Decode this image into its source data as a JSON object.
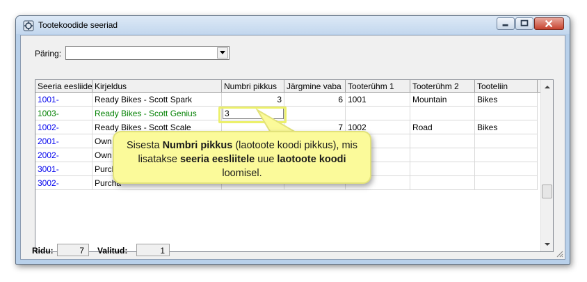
{
  "window": {
    "title": "Tootekoodide seeriad"
  },
  "query": {
    "label": "Päring:",
    "value": ""
  },
  "grid": {
    "columns": [
      "Seeria eesliide",
      "Kirjeldus",
      "Numbri pikkus",
      "Järgmine vaba",
      "Tooterühm 1",
      "Tooterühm 2",
      "Tooteliin"
    ],
    "rows": [
      {
        "prefix": "1001-",
        "desc": "Ready Bikes - Scott Spark",
        "len": "3",
        "next": "6",
        "g1": "1001",
        "g2": "Mountain",
        "line": "Bikes",
        "color": "blue"
      },
      {
        "prefix": "1003-",
        "desc": "Ready Bikes - Scott Genius",
        "len": "3",
        "next": "",
        "g1": "",
        "g2": "",
        "line": "",
        "color": "green"
      },
      {
        "prefix": "1002-",
        "desc": "Ready Bikes - Scott Scale",
        "len": "",
        "next": "7",
        "g1": "1002",
        "g2": "Road",
        "line": "Bikes",
        "color": "blue"
      },
      {
        "prefix": "2001-",
        "desc": "Own",
        "len": "",
        "next": "",
        "g1": "",
        "g2": "",
        "line": "",
        "color": "blue"
      },
      {
        "prefix": "2002-",
        "desc": "Own",
        "len": "",
        "next": "",
        "g1": "",
        "g2": "",
        "line": "",
        "color": "blue"
      },
      {
        "prefix": "3001-",
        "desc": "Purch",
        "len": "",
        "next": "",
        "g1": "",
        "g2": "",
        "line": "",
        "color": "blue"
      },
      {
        "prefix": "3002-",
        "desc": "Purcha",
        "len": "",
        "next": "",
        "g1": "",
        "g2": "",
        "line": "",
        "color": "blue"
      }
    ]
  },
  "callout": {
    "t1": "Sisesta ",
    "b1": "Numbri pikkus",
    "t2": " (laotoote koodi pikkus), mis lisatakse ",
    "b2": "seeria eesliitele",
    "t3": " uue ",
    "b3": "laotoote koodi",
    "t4": " loomisel."
  },
  "status": {
    "rows_label": "Ridu:",
    "rows_value": "7",
    "selected_label": "Valitud:",
    "selected_value": "1"
  },
  "colors": {
    "link": "#0000ee",
    "active": "#008000",
    "callout": "#fbfa9a",
    "highlight": "#ecf06b"
  },
  "icons": [
    "app-icon",
    "minimize-icon",
    "maximize-icon",
    "close-icon",
    "chevron-down-icon",
    "scroll-up-icon",
    "scroll-down-icon",
    "resize-grip-icon"
  ]
}
